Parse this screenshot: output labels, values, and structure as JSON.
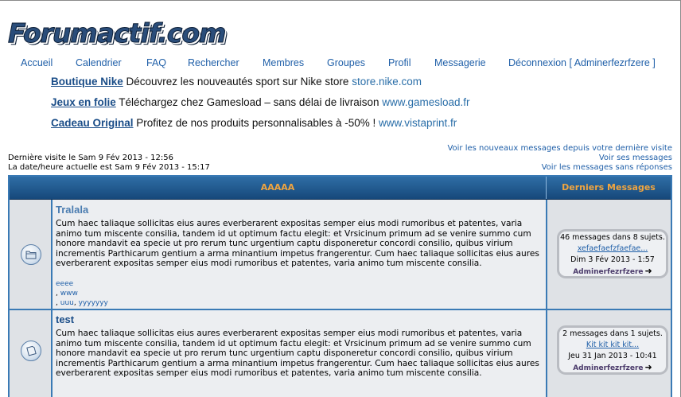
{
  "logo": {
    "text": "Forumactif.com"
  },
  "nav": [
    "Accueil",
    "Calendrier",
    "FAQ",
    "Rechercher",
    "Membres",
    "Groupes",
    "Profil",
    "Messagerie",
    "Déconnexion [ Adminerfezrfzere ]"
  ],
  "ads": [
    {
      "title": "Boutique Nike",
      "text": "Découvrez les nouveautés sport sur Nike store",
      "url": "store.nike.com"
    },
    {
      "title": "Jeux en folie",
      "text": "Téléchargez chez Gamesload – sans délai de livraison",
      "url": "www.gamesload.fr"
    },
    {
      "title": "Cadeau Original",
      "text": "Profitez de nos produits personnalisables à -50% !",
      "url": "www.vistaprint.fr"
    }
  ],
  "visit": {
    "last": "Dernière visite le Sam 9 Fév 2013 - 12:56",
    "now": "La date/heure actuelle est Sam 9 Fév 2013 - 15:17"
  },
  "links": {
    "new_since": "Voir les nouveaux messages depuis votre dernière visite",
    "own": "Voir ses messages",
    "unanswered": "Voir les messages sans réponses"
  },
  "table": {
    "header_main": "AAAAA",
    "header_last": "Derniers Messages"
  },
  "forums": [
    {
      "title": "Tralala",
      "title_color": "#4a7cb0",
      "icon": "folder-icon",
      "description": "Cum haec taliaque sollicitas eius aures everberarent expositas semper eius modi rumoribus et patentes, varia animo tum miscente consilia, tandem id ut optimum factu elegit: et Vrsicinum primum ad se venire summo cum honore mandavit ea specie ut pro rerum tunc urgentium captu disponeretur concordi consilio, quibus virium incrementis Parthicarum gentium a arma minantium impetus frangerentur. Cum haec taliaque sollicitas eius aures everberarent expositas semper eius modi rumoribus et patentes, varia animo tum miscente consilia.",
      "subforums": [
        "eeee",
        "www",
        "uuu",
        "yyyyyyy"
      ],
      "last": {
        "count": "46 messages dans 8 sujets.",
        "topic": "xefaefaefzfaefae...",
        "date": "Dim 3 Fév 2013 - 1:57",
        "user": "Adminerfezrfzere"
      }
    },
    {
      "title": "test",
      "title_color": "#1a4d88",
      "icon": "document-icon",
      "description": "Cum haec taliaque sollicitas eius aures everberarent expositas semper eius modi rumoribus et patentes, varia animo tum miscente consilia, tandem id ut optimum factu elegit: et Vrsicinum primum ad se venire summo cum honore mandavit ea specie ut pro rerum tunc urgentium captu disponeretur concordi consilio, quibus virium incrementis Parthicarum gentium a arma minantium impetus frangerentur. Cum haec taliaque sollicitas eius aures everberarent expositas semper eius modi rumoribus et patentes, varia animo tum miscente consilia.",
      "subforums": [],
      "last": {
        "count": "2 messages dans 1 sujets.",
        "topic": "Kit kit kit kit...",
        "date": "Jeu 31 Jan 2013 - 10:41",
        "user": "Adminerfezrfzere"
      }
    }
  ]
}
